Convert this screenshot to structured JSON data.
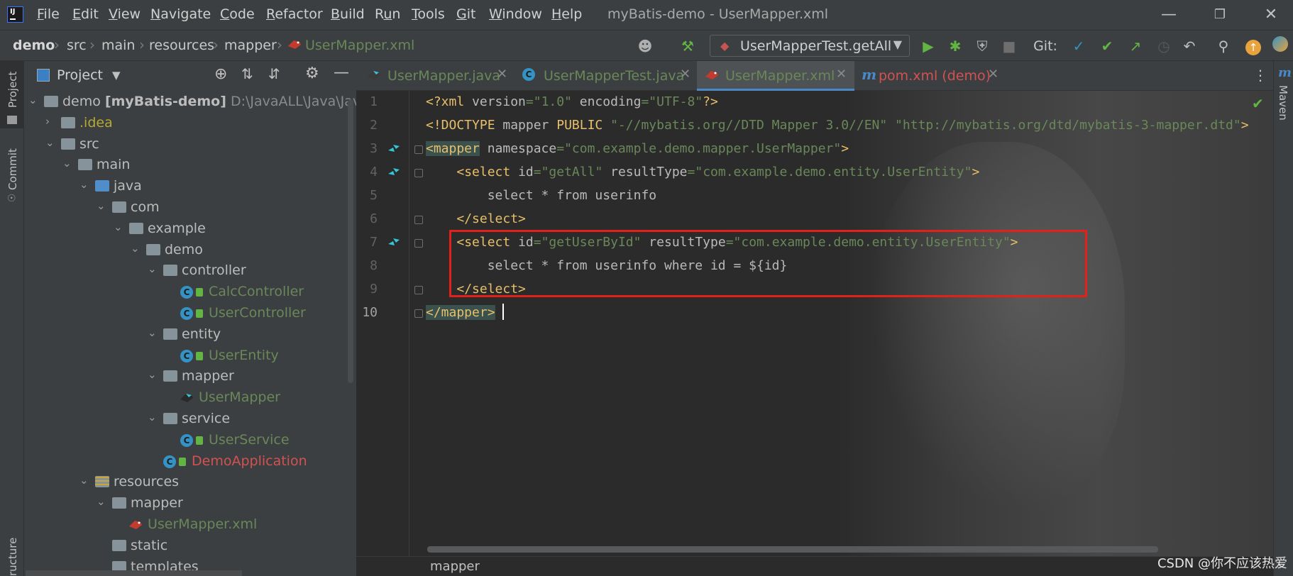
{
  "menu": {
    "items": [
      "File",
      "Edit",
      "View",
      "Navigate",
      "Code",
      "Refactor",
      "Build",
      "Run",
      "Tools",
      "Git",
      "Window",
      "Help"
    ],
    "mnemonics": [
      "F",
      "E",
      "V",
      "N",
      "C",
      "R",
      "B",
      "u",
      "T",
      "G",
      "W",
      "H"
    ]
  },
  "window": {
    "title": "myBatis-demo - UserMapper.xml"
  },
  "breadcrumbs": [
    "demo",
    "src",
    "main",
    "resources",
    "mapper",
    "UserMapper.xml"
  ],
  "toolbar": {
    "run_config": "UserMapperTest.getAll",
    "git_label": "Git:"
  },
  "project": {
    "title": "Project",
    "root_name": "demo",
    "root_module": "[myBatis-demo]",
    "root_path": "D:\\JavaALL\\Java\\Java-C",
    "tree": [
      {
        "label": ".idea",
        "depth": 1,
        "kind": "folder",
        "expanded": false
      },
      {
        "label": "src",
        "depth": 1,
        "kind": "folder",
        "expanded": true
      },
      {
        "label": "main",
        "depth": 2,
        "kind": "folder",
        "expanded": true
      },
      {
        "label": "java",
        "depth": 3,
        "kind": "source-folder",
        "expanded": true
      },
      {
        "label": "com",
        "depth": 4,
        "kind": "package",
        "expanded": true
      },
      {
        "label": "example",
        "depth": 5,
        "kind": "package",
        "expanded": true
      },
      {
        "label": "demo",
        "depth": 6,
        "kind": "package",
        "expanded": true
      },
      {
        "label": "controller",
        "depth": 7,
        "kind": "package",
        "expanded": true
      },
      {
        "label": "CalcController",
        "depth": 8,
        "kind": "class"
      },
      {
        "label": "UserController",
        "depth": 8,
        "kind": "class"
      },
      {
        "label": "entity",
        "depth": 7,
        "kind": "package",
        "expanded": true
      },
      {
        "label": "UserEntity",
        "depth": 8,
        "kind": "class"
      },
      {
        "label": "mapper",
        "depth": 7,
        "kind": "package",
        "expanded": true
      },
      {
        "label": "UserMapper",
        "depth": 8,
        "kind": "mybatis"
      },
      {
        "label": "service",
        "depth": 7,
        "kind": "package",
        "expanded": true
      },
      {
        "label": "UserService",
        "depth": 8,
        "kind": "class"
      },
      {
        "label": "DemoApplication",
        "depth": 7,
        "kind": "app-class"
      },
      {
        "label": "resources",
        "depth": 3,
        "kind": "resources-folder",
        "expanded": true
      },
      {
        "label": "mapper",
        "depth": 4,
        "kind": "folder",
        "expanded": true
      },
      {
        "label": "UserMapper.xml",
        "depth": 5,
        "kind": "mybatis-xml"
      },
      {
        "label": "static",
        "depth": 4,
        "kind": "folder"
      },
      {
        "label": "templates",
        "depth": 4,
        "kind": "folder"
      }
    ]
  },
  "side_tabs": {
    "project": "Project",
    "commit": "Commit",
    "structure": "ructure",
    "maven": "Maven"
  },
  "tabs": [
    {
      "label": "UserMapper.java",
      "color": "#6a8759"
    },
    {
      "label": "UserMapperTest.java",
      "color": "#6a8759"
    },
    {
      "label": "UserMapper.xml",
      "color": "#6a8759",
      "active": true
    },
    {
      "label": "pom.xml (demo)",
      "color": "#d25252"
    }
  ],
  "editor": {
    "lines": [
      {
        "n": "1",
        "html": "<span class=\"k\">&lt;?xml </span><span class=\"a\">version</span><span class=\"s\">=\"1.0\"</span><span class=\"a\"> encoding</span><span class=\"s\">=\"UTF-8\"</span><span class=\"k\">?&gt;</span>"
      },
      {
        "n": "2",
        "html": "<span class=\"k\">&lt;!DOCTYPE </span><span class=\"a\">mapper </span><span class=\"k\">PUBLIC </span><span class=\"s\">\"-//mybatis.org//DTD Mapper 3.0//EN\" \"http://mybatis.org/dtd/mybatis-3-mapper.dtd\"</span><span class=\"k\">&gt;</span>"
      },
      {
        "n": "3",
        "html": "<span class=\"k hl\">&lt;mapper</span><span class=\"a\"> namespace</span><span class=\"s\">=\"com.example.demo.mapper.UserMapper\"</span><span class=\"k\">&gt;</span>"
      },
      {
        "n": "4",
        "html": "    <span class=\"k\">&lt;select </span><span class=\"a\">id</span><span class=\"s\">=\"getAll\"</span><span class=\"a\"> resultType</span><span class=\"s\">=\"com.example.demo.entity.UserEntity\"</span><span class=\"k\">&gt;</span>"
      },
      {
        "n": "5",
        "html": "        <span class=\"a\">select * from userinfo</span>"
      },
      {
        "n": "6",
        "html": "    <span class=\"k\">&lt;/select&gt;</span>"
      },
      {
        "n": "7",
        "html": "    <span class=\"k\">&lt;select </span><span class=\"a\">id</span><span class=\"s\">=\"getUserById\"</span><span class=\"a\"> resultType</span><span class=\"s\">=\"com.example.demo.entity.UserEntity\"</span><span class=\"k\">&gt;</span>"
      },
      {
        "n": "8",
        "html": "        <span class=\"a\">select * from userinfo where id = ${id}</span>"
      },
      {
        "n": "9",
        "html": "    <span class=\"k\">&lt;/select&gt;</span>"
      },
      {
        "n": "10",
        "html": "<span class=\"k hl\">&lt;/mapper&gt;</span>"
      }
    ],
    "bottom_breadcrumb": "mapper"
  },
  "watermark": "CSDN @你不应该热爱",
  "colors": {
    "background": "#2b2b2b",
    "panel": "#3c3f41",
    "xml_tag": "#e8bf6a",
    "xml_value": "#6a8759",
    "highlight_box": "#e3211b"
  }
}
